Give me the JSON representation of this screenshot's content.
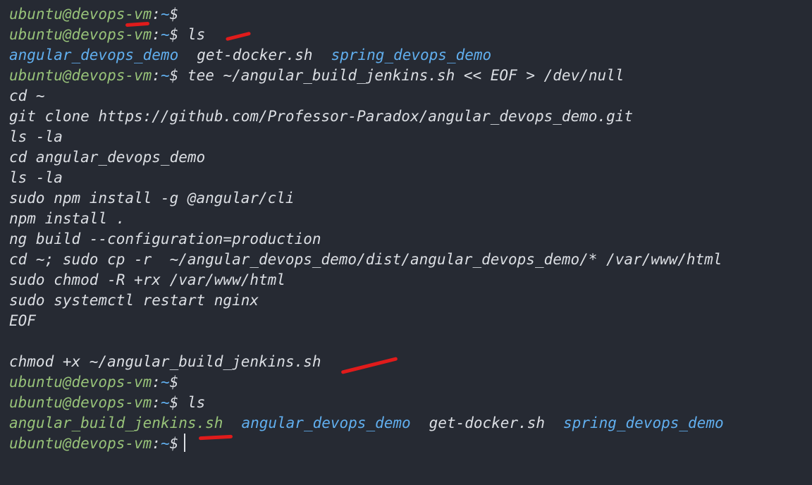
{
  "prompt": {
    "user": "ubuntu@devops-vm",
    "sep": ":",
    "path": "~",
    "symbol": "$"
  },
  "cmd_ls": "ls",
  "ls1": {
    "dirs": [
      "angular_devops_demo",
      "spring_devops_demo"
    ],
    "file": "get-docker.sh"
  },
  "tee_cmd": "tee ~/angular_build_jenkins.sh << EOF > /dev/null",
  "heredoc": [
    "cd ~",
    "git clone https://github.com/Professor-Paradox/angular_devops_demo.git",
    "ls -la",
    "cd angular_devops_demo",
    "ls -la",
    "sudo npm install -g @angular/cli",
    "npm install .",
    "ng build --configuration=production",
    "cd ~; sudo cp -r  ~/angular_devops_demo/dist/angular_devops_demo/* /var/www/html",
    "sudo chmod -R +rx /var/www/html",
    "sudo systemctl restart nginx",
    "EOF"
  ],
  "chmod_cmd": "chmod +x ~/angular_build_jenkins.sh",
  "ls2": {
    "exe": "angular_build_jenkins.sh",
    "dir1": "angular_devops_demo",
    "file": "get-docker.sh",
    "dir2": "spring_devops_demo"
  },
  "colors": {
    "background": "#262a33",
    "prompt_user": "#98c379",
    "directory": "#61afef",
    "text": "#dcdfe4",
    "annotation": "#e01b1b"
  }
}
